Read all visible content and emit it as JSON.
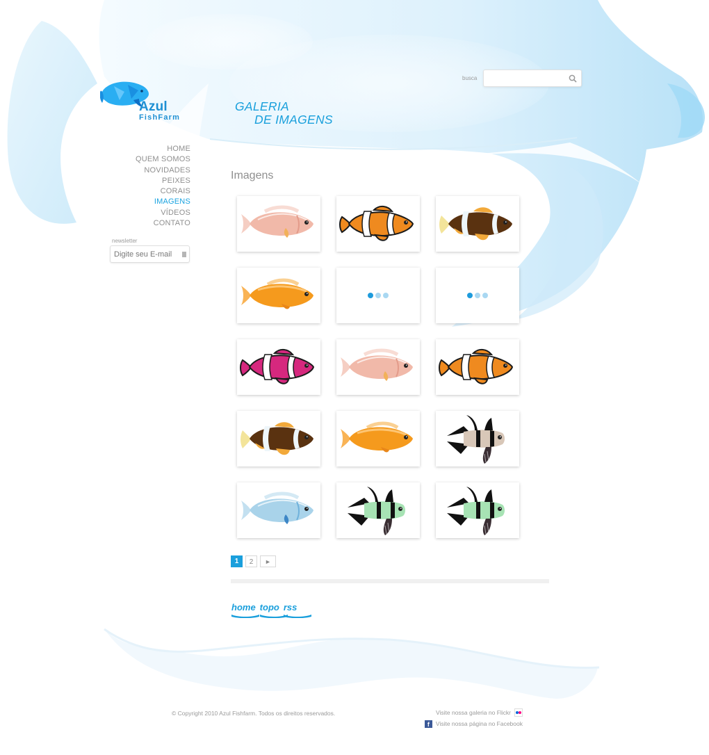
{
  "brand": {
    "name": "Azul",
    "subname": "FishFarm",
    "subname_a": "Fish",
    "subname_b": "Farm"
  },
  "nav": {
    "items": [
      {
        "label": "HOME",
        "active": false
      },
      {
        "label": "QUEM SOMOS",
        "active": false
      },
      {
        "label": "NOVIDADES",
        "active": false
      },
      {
        "label": "PEIXES",
        "active": false
      },
      {
        "label": "CORAIS",
        "active": false
      },
      {
        "label": "IMAGENS",
        "active": true
      },
      {
        "label": "VÍDEOS",
        "active": false
      },
      {
        "label": "CONTATO",
        "active": false
      }
    ]
  },
  "newsletter": {
    "label": "newsletter",
    "placeholder": "Digite seu E-mail"
  },
  "search": {
    "label": "busca",
    "value": ""
  },
  "page": {
    "title_line1": "GALERIA",
    "title_line2": "DE IMAGENS",
    "section": "Imagens"
  },
  "gallery": {
    "items": [
      {
        "kind": "anemone-pink",
        "loading": false
      },
      {
        "kind": "clown-orange",
        "loading": false
      },
      {
        "kind": "clarkii",
        "loading": false
      },
      {
        "kind": "orange-solid",
        "loading": false
      },
      {
        "kind": "loading",
        "loading": true
      },
      {
        "kind": "loading",
        "loading": true
      },
      {
        "kind": "clown-magenta",
        "loading": false
      },
      {
        "kind": "anemone-pink",
        "loading": false
      },
      {
        "kind": "clown-orange",
        "loading": false
      },
      {
        "kind": "clarkii",
        "loading": false
      },
      {
        "kind": "orange-solid",
        "loading": false
      },
      {
        "kind": "cardinal-black",
        "loading": false
      },
      {
        "kind": "anemone-blue",
        "loading": false
      },
      {
        "kind": "cardinal-green",
        "loading": false
      },
      {
        "kind": "cardinal-green",
        "loading": false
      }
    ]
  },
  "pagination": {
    "current": "1",
    "pages": [
      "2"
    ],
    "next": "►"
  },
  "footer": {
    "links": [
      {
        "label": "home"
      },
      {
        "label": "topo"
      },
      {
        "label": "rss"
      }
    ],
    "copyright": "© Copyright 2010 Azul Fishfarm. Todos os direitos reservados.",
    "flickr": "Visite nossa galeria no Flickr",
    "facebook": "Visite nossa página no Facebook"
  },
  "colors": {
    "accent": "#1a9fdc",
    "loader_dot_dark": "#1e9bdc",
    "loader_dot_light": "#a9d8f2",
    "wave_light": "#dff1fb"
  },
  "icons": {
    "search": "search-icon",
    "newsletter": "document-icon",
    "flickr": "flickr-icon",
    "facebook": "facebook-icon"
  }
}
